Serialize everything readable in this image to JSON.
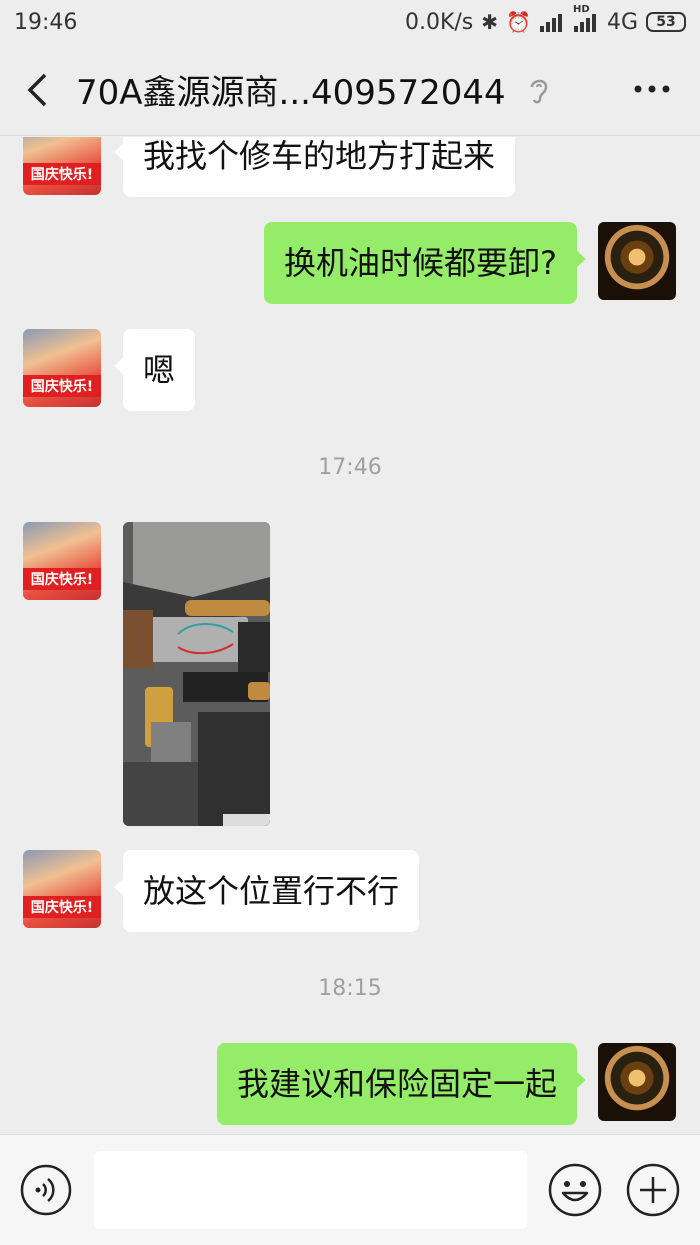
{
  "status_bar": {
    "time": "19:46",
    "net_speed": "0.0K/s",
    "network_type": "4G",
    "battery": "53",
    "hd_label": "HD"
  },
  "header": {
    "title": "70A鑫源源商...409572044"
  },
  "messages": [
    {
      "side": "left",
      "type": "text",
      "text": "我找个修车的地方打起来",
      "avatar_tag": "国庆快乐!"
    },
    {
      "side": "right",
      "type": "text",
      "text": "换机油时候都要卸?"
    },
    {
      "side": "left",
      "type": "text",
      "text": "嗯",
      "avatar_tag": "国庆快乐!"
    },
    {
      "type": "time",
      "text": "17:46"
    },
    {
      "side": "left",
      "type": "image",
      "avatar_tag": "国庆快乐!"
    },
    {
      "side": "left",
      "type": "text",
      "text": "放这个位置行不行",
      "avatar_tag": "国庆快乐!"
    },
    {
      "type": "time",
      "text": "18:15"
    },
    {
      "side": "right",
      "type": "text",
      "text": "我建议和保险固定一起"
    }
  ],
  "input": {
    "value": "",
    "placeholder": ""
  },
  "colors": {
    "background": "#ededed",
    "bubble_self": "#95ec69",
    "bubble_other": "#ffffff"
  }
}
